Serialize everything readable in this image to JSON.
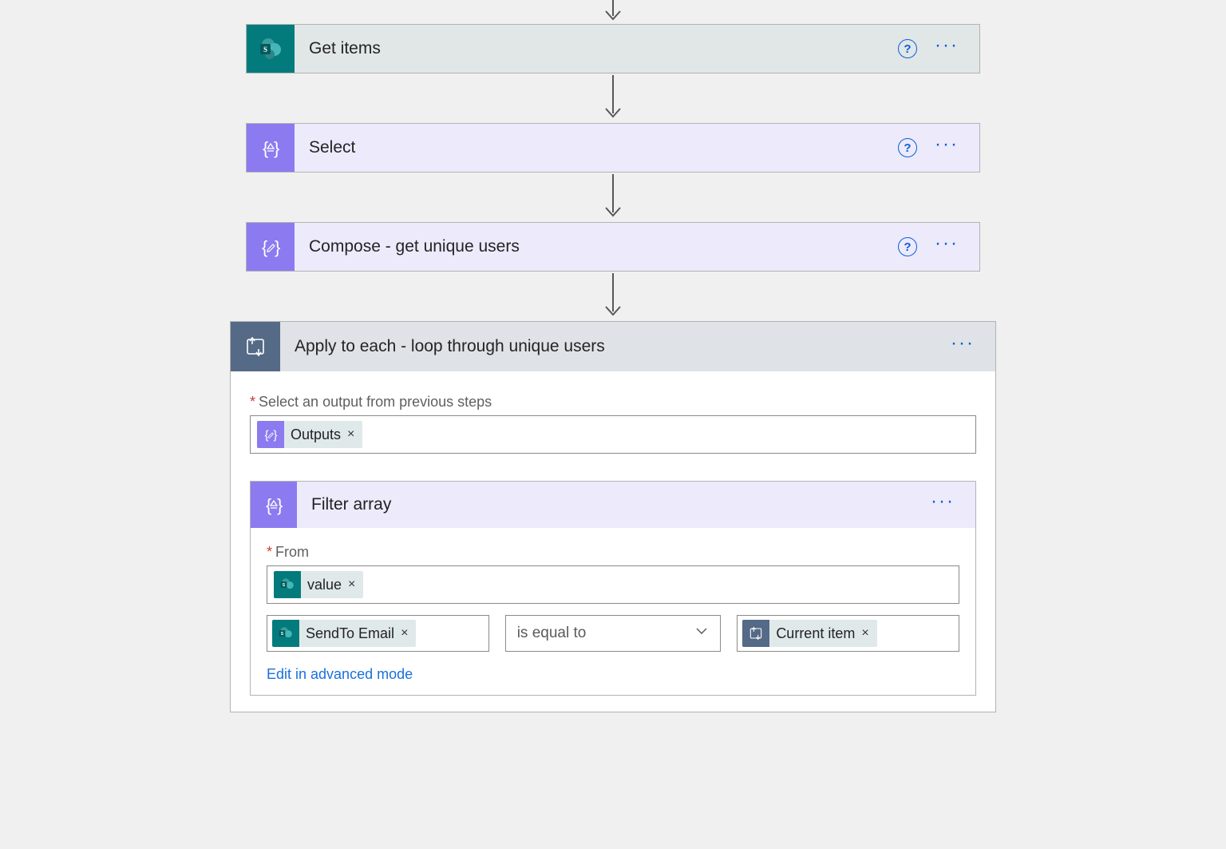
{
  "actions": {
    "get_items": {
      "title": "Get items"
    },
    "select": {
      "title": "Select"
    },
    "compose": {
      "title": "Compose - get unique users"
    }
  },
  "loop": {
    "title": "Apply to each - loop through unique users",
    "input_label": "Select an output from previous steps",
    "input_token": {
      "label": "Outputs"
    }
  },
  "filter": {
    "title": "Filter array",
    "from_label": "From",
    "from_token": {
      "label": "value"
    },
    "left_token": {
      "label": "SendTo Email"
    },
    "operator": {
      "label": "is equal to"
    },
    "right_token": {
      "label": "Current item"
    },
    "advanced_link": "Edit in advanced mode"
  },
  "glyphs": {
    "remove": "×",
    "required": "*",
    "help": "?"
  }
}
